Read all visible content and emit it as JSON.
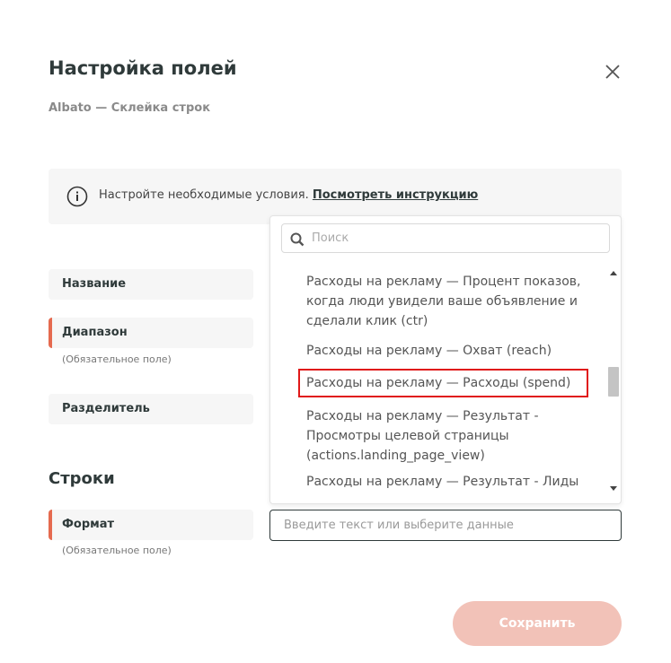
{
  "dialog": {
    "title": "Настройка полей",
    "subtitle": "Albato — Склейка строк"
  },
  "info": {
    "text": "Настройте необходимые условия. ",
    "link": "Посмотреть инструкцию"
  },
  "fields": {
    "name_label": "Название",
    "range_label": "Диапазон",
    "range_note": "(Обязательное поле)",
    "separator_label": "Разделитель"
  },
  "section": {
    "title": "Строки",
    "format_label": "Формат",
    "format_note": "(Обязательное поле)"
  },
  "dropdown": {
    "search_placeholder": "Поиск",
    "options": [
      "Расходы на рекламу — Процент показов, когда люди увидели ваше объявление и сделали клик (ctr)",
      "Расходы на рекламу — Охват (reach)",
      "Расходы на рекламу — Расходы (spend)",
      "Расходы на рекламу — Результат - Просмотры целевой страницы (actions.landing_page_view)",
      "Расходы на рекламу — Результат - Лиды"
    ],
    "highlighted_index": 2
  },
  "input": {
    "placeholder": "Введите текст или выберите данные"
  },
  "save_label": "Сохранить",
  "colors": {
    "accent": "#e56a4f",
    "save_button": "#f2c2b8",
    "highlight_outline": "#e01818"
  }
}
